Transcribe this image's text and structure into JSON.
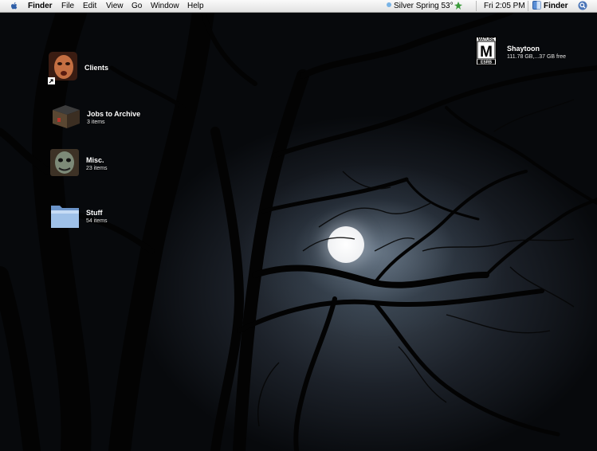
{
  "menubar": {
    "app_name": "Finder",
    "menus": [
      "File",
      "Edit",
      "View",
      "Go",
      "Window",
      "Help"
    ],
    "weather": "Silver Spring 53°",
    "clock": "Fri 2:05 PM",
    "active_app": "Finder"
  },
  "desktop_icons": {
    "clients": {
      "name": "Clients",
      "icon": "face-portrait-icon"
    },
    "jobs": {
      "name": "Jobs to Archive",
      "info": "3 items",
      "icon": "archive-box-icon"
    },
    "misc": {
      "name": "Misc.",
      "info": "23 items",
      "icon": "creature-face-icon"
    },
    "stuff": {
      "name": "Stuff",
      "info": "54 items",
      "icon": "blue-folder-icon"
    },
    "drive": {
      "name": "Shaytoon",
      "info": "111.78 GB,...37 GB free",
      "icon": "esrb-mature-icon",
      "badge_top": "MATURE",
      "badge_letter": "M",
      "badge_bottom": "ESRB"
    }
  },
  "colors": {
    "menubar_bg": "#ececec",
    "folder_blue": "#7fa6d8",
    "moon": "#f4f5f7"
  }
}
